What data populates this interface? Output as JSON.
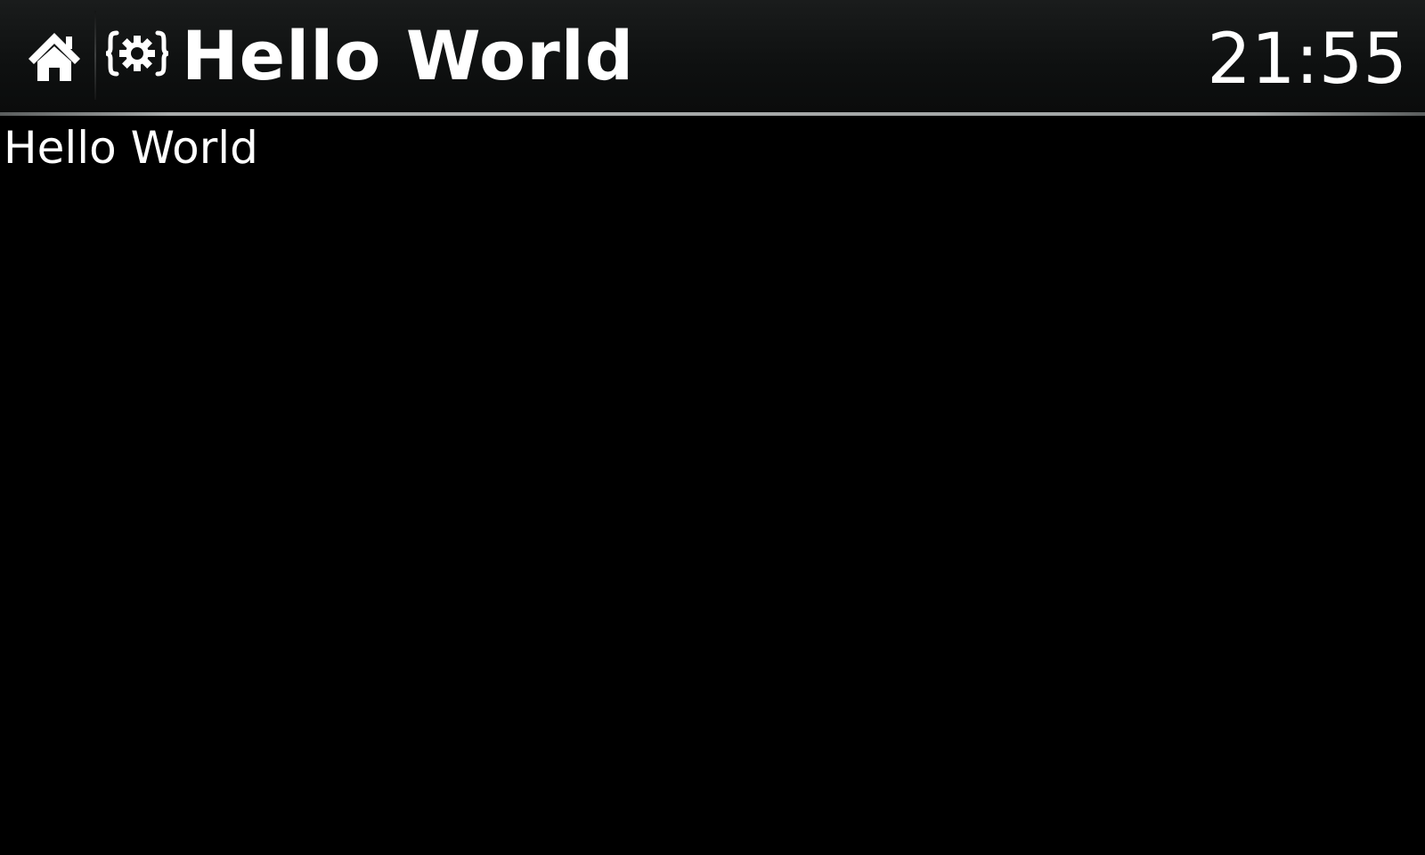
{
  "header": {
    "home_icon": "home-icon",
    "app_icon": "settings-code-icon",
    "title": "Hello World",
    "clock": "21:55"
  },
  "main": {
    "text": "Hello World"
  },
  "colors": {
    "background": "#000000",
    "header_background": "#0e1010",
    "text": "#ffffff",
    "rule": "#a9acac"
  }
}
